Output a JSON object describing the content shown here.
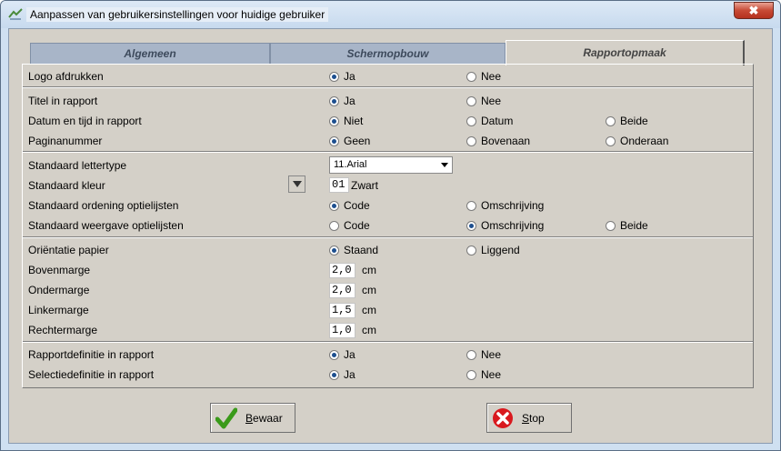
{
  "window": {
    "title": "Aanpassen van gebruikersinstellingen voor huidige gebruiker",
    "close_label": "✖"
  },
  "tabs": [
    {
      "label": "Algemeen",
      "active": false
    },
    {
      "label": "Schermopbouw",
      "active": false
    },
    {
      "label": "Rapportopmaak",
      "active": true
    }
  ],
  "options": {
    "logo": {
      "label": "Logo afdrukken",
      "choices": [
        "Ja",
        "Nee"
      ],
      "selected": "Ja"
    },
    "titel": {
      "label": "Titel in rapport",
      "choices": [
        "Ja",
        "Nee"
      ],
      "selected": "Ja"
    },
    "datum": {
      "label": "Datum en tijd in rapport",
      "choices": [
        "Niet",
        "Datum",
        "Beide"
      ],
      "selected": "Niet"
    },
    "pagina": {
      "label": "Paginanummer",
      "choices": [
        "Geen",
        "Bovenaan",
        "Onderaan"
      ],
      "selected": "Geen"
    },
    "lettertype": {
      "label": "Standaard lettertype",
      "value": "11.Arial"
    },
    "kleur": {
      "label": "Standaard kleur",
      "code": "01",
      "name": "Zwart"
    },
    "ordening": {
      "label": "Standaard ordening optielijsten",
      "choices": [
        "Code",
        "Omschrijving"
      ],
      "selected": "Code"
    },
    "weergave": {
      "label": "Standaard weergave optielijsten",
      "choices": [
        "Code",
        "Omschrijving",
        "Beide"
      ],
      "selected": "Omschrijving"
    },
    "orientatie": {
      "label": "Oriëntatie papier",
      "choices": [
        "Staand",
        "Liggend"
      ],
      "selected": "Staand"
    },
    "bovenmarge": {
      "label": "Bovenmarge",
      "value": "2,0",
      "unit": "cm"
    },
    "ondermarge": {
      "label": "Ondermarge",
      "value": "2,0",
      "unit": "cm"
    },
    "linkermarge": {
      "label": "Linkermarge",
      "value": "1,5",
      "unit": "cm"
    },
    "rechtermarge": {
      "label": "Rechtermarge",
      "value": "1,0",
      "unit": "cm"
    },
    "rapportdef": {
      "label": "Rapportdefinitie in rapport",
      "choices": [
        "Ja",
        "Nee"
      ],
      "selected": "Ja"
    },
    "selectiedef": {
      "label": "Selectiedefinitie in rapport",
      "choices": [
        "Ja",
        "Nee"
      ],
      "selected": "Ja"
    }
  },
  "buttons": {
    "save_first": "B",
    "save_rest": "ewaar",
    "stop_first": "S",
    "stop_rest": "top"
  },
  "colors": {
    "accent": "#1d4f8f",
    "save_icon": "#3a9a1a",
    "stop_icon": "#d9191e"
  }
}
